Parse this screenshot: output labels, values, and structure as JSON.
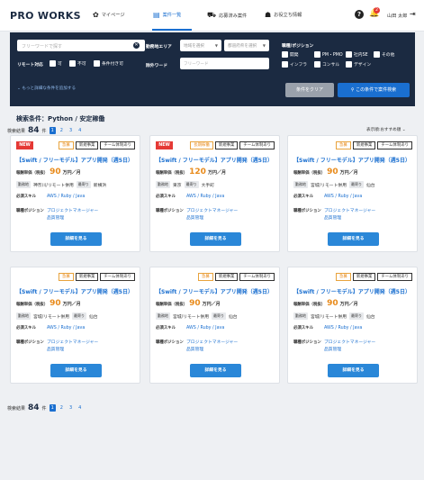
{
  "nav": {
    "logo": "PRO WORKS",
    "items": [
      {
        "label": "マイページ",
        "icon": "gear-icon"
      },
      {
        "label": "案件一覧",
        "icon": "list-icon"
      },
      {
        "label": "応募済み案件",
        "icon": "car-icon"
      },
      {
        "label": "お役立ち情報",
        "icon": "people-icon"
      }
    ],
    "notifications": "2",
    "user": "山田 太郎"
  },
  "search": {
    "keyword_placeholder": "フリーワードで探す",
    "remote_label": "リモート対応",
    "remote_options": [
      "可",
      "不可",
      "条件付き可"
    ],
    "area_label": "勤務地エリア",
    "region_placeholder": "地域を選択",
    "prefecture_placeholder": "都道府県を選択",
    "exclude_label": "除外ワード",
    "exclude_placeholder": "フリーワード",
    "position_label": "職種/ポジション",
    "positions": [
      "開発",
      "PM・PMO",
      "社内SE",
      "その他",
      "インフラ",
      "コンサル",
      "デザイン"
    ],
    "more_link": "もっと詳細な条件を追加する",
    "clear_button": "条件をクリア",
    "search_button": "この条件で案件検索"
  },
  "results": {
    "condition": "検索条件：Python / 安定稼働",
    "count_label": "検索結果",
    "count": "84",
    "count_unit": "件",
    "pages": [
      "1",
      "2",
      "3",
      "4"
    ],
    "sort": "表示順:おすすめ順"
  },
  "cards": [
    {
      "new": "NEW",
      "tags": [
        "急募",
        "新規事業",
        "チーム体制あり"
      ],
      "title": "【Swift / フリーモデル】アプリ開発（週5日）",
      "price_label": "報酬単価（税抜）",
      "price": "90",
      "price_unit": "万円／月",
      "loc_chip": "勤務地",
      "loc": "神奈川/リモート併用",
      "station_chip": "最寄り",
      "station": "新横浜",
      "skills_label": "必須スキル",
      "skills": "AWS / Ruby / Java",
      "position_label": "職種ポジション",
      "position1": "プロジェクトマネージャー",
      "position2": "品質管理",
      "detail": "詳細を見る"
    },
    {
      "new": "NEW",
      "tags": [
        "長期稼働",
        "新規事業",
        "チーム体制あり"
      ],
      "title": "【Swift / フリーモデル】アプリ開発（週5日）",
      "price_label": "報酬単価（税抜）",
      "price": "120",
      "price_unit": "万円／月",
      "loc_chip": "勤務地",
      "loc": "東京",
      "station_chip": "最寄り",
      "station": "大手町",
      "skills_label": "必須スキル",
      "skills": "AWS / Ruby / Java",
      "position_label": "職種ポジション",
      "position1": "プロジェクトマネージャー",
      "position2": "品質管理",
      "detail": "詳細を見る"
    },
    {
      "new": "",
      "tags": [
        "急募",
        "新規事業",
        "チーム体制あり"
      ],
      "title": "【Swift / フリーモデル】アプリ開発（週5日）",
      "price_label": "報酬単価（税抜）",
      "price": "90",
      "price_unit": "万円／月",
      "loc_chip": "勤務地",
      "loc": "宮城/リモート併用",
      "station_chip": "最寄り",
      "station": "仙台",
      "skills_label": "必須スキル",
      "skills": "AWS / Ruby / Java",
      "position_label": "職種ポジション",
      "position1": "プロジェクトマネージャー",
      "position2": "品質管理",
      "detail": "詳細を見る"
    },
    {
      "new": "",
      "tags": [
        "急募",
        "新規事業",
        "チーム体制あり"
      ],
      "title": "【Swift / フリーモデル】アプリ開発（週5日）",
      "price_label": "報酬単価（税抜）",
      "price": "90",
      "price_unit": "万円／月",
      "loc_chip": "勤務地",
      "loc": "宮城/リモート併用",
      "station_chip": "最寄り",
      "station": "仙台",
      "skills_label": "必須スキル",
      "skills": "AWS / Ruby / Java",
      "position_label": "職種ポジション",
      "position1": "プロジェクトマネージャー",
      "position2": "品質管理",
      "detail": "詳細を見る"
    },
    {
      "new": "",
      "tags": [
        "急募",
        "新規事業",
        "チーム体制あり"
      ],
      "title": "【Swift / フリーモデル】アプリ開発（週5日）",
      "price_label": "報酬単価（税抜）",
      "price": "90",
      "price_unit": "万円／月",
      "loc_chip": "勤務地",
      "loc": "宮城/リモート併用",
      "station_chip": "最寄り",
      "station": "仙台",
      "skills_label": "必須スキル",
      "skills": "AWS / Ruby / Java",
      "position_label": "職種ポジション",
      "position1": "プロジェクトマネージャー",
      "position2": "品質管理",
      "detail": "詳細を見る"
    },
    {
      "new": "",
      "tags": [
        "急募",
        "新規事業",
        "チーム体制あり"
      ],
      "title": "【Swift / フリーモデル】アプリ開発（週5日）",
      "price_label": "報酬単価（税抜）",
      "price": "90",
      "price_unit": "万円／月",
      "loc_chip": "勤務地",
      "loc": "宮城/リモート併用",
      "station_chip": "最寄り",
      "station": "仙台",
      "skills_label": "必須スキル",
      "skills": "AWS / Ruby / Java",
      "position_label": "職種ポジション",
      "position1": "プロジェクトマネージャー",
      "position2": "品質管理",
      "detail": "詳細を見る"
    }
  ]
}
